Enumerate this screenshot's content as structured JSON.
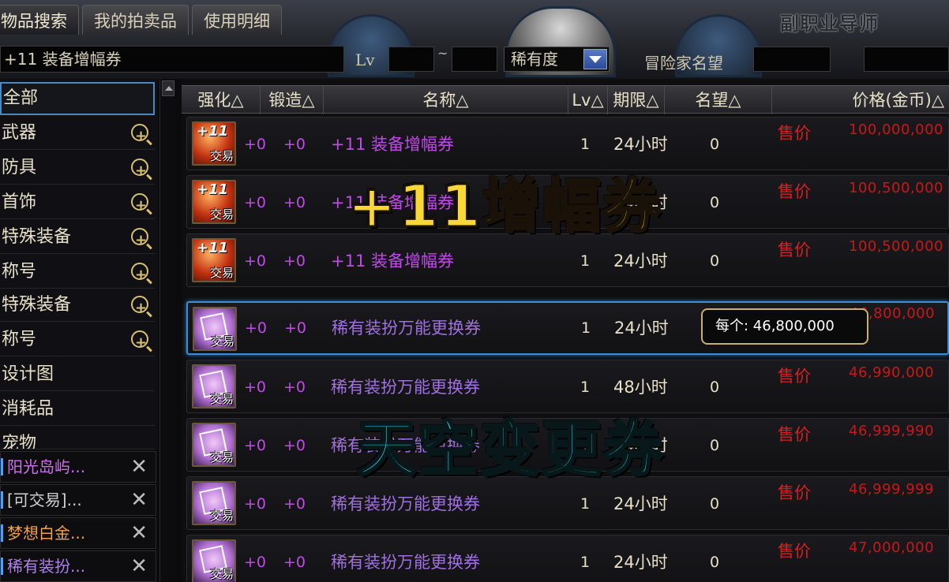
{
  "tabs": [
    "物品搜索",
    "我的拍卖品",
    "使用明细"
  ],
  "brand": {
    "text": "副职业导师"
  },
  "search": {
    "item_value": "+11 装备增幅券",
    "lv_label": "Lv",
    "lv_separator": "~",
    "rarity_label": "稀有度",
    "fame_label": "冒险家名望"
  },
  "sidebar": {
    "categories": [
      {
        "label": "全部",
        "zoom": false
      },
      {
        "label": "武器",
        "zoom": true
      },
      {
        "label": "防具",
        "zoom": true
      },
      {
        "label": "首饰",
        "zoom": true
      },
      {
        "label": "特殊装备",
        "zoom": true
      },
      {
        "label": "称号",
        "zoom": true
      },
      {
        "label": "特殊装备",
        "zoom": true
      },
      {
        "label": "称号",
        "zoom": true
      },
      {
        "label": "设计图",
        "zoom": false
      },
      {
        "label": "消耗品",
        "zoom": false
      },
      {
        "label": "宠物",
        "zoom": false
      }
    ],
    "filters": [
      {
        "label": "阳光岛屿...",
        "color": "#d070f0"
      },
      {
        "label": "[可交易]...",
        "color": "#cfcfcf"
      },
      {
        "label": "梦想白金...",
        "color": "#f0a050"
      },
      {
        "label": "稀有装扮...",
        "color": "#b080f0"
      }
    ]
  },
  "table": {
    "headers": [
      "强化△",
      "锻造△",
      "名称△",
      "Lv△",
      "期限△",
      "名望△",
      "价格(金币)△"
    ],
    "rows": [
      {
        "icon": "amplify-ticket-icon",
        "icon_text": "+11",
        "trade": "交易",
        "upgrade": "+0",
        "forge": "+0",
        "name": "+11 装备增幅券",
        "kind": "amp",
        "lv": "1",
        "duration": "24小时",
        "fame": "0",
        "sell": "售价",
        "price": "100,000,000"
      },
      {
        "icon": "amplify-ticket-icon",
        "icon_text": "+11",
        "trade": "交易",
        "upgrade": "+0",
        "forge": "+0",
        "name": "+11 装备增幅券",
        "kind": "amp",
        "lv": "1",
        "duration": "24小时",
        "fame": "0",
        "sell": "售价",
        "price": "100,500,000"
      },
      {
        "icon": "amplify-ticket-icon",
        "icon_text": "+11",
        "trade": "交易",
        "upgrade": "+0",
        "forge": "+0",
        "name": "+11 装备增幅券",
        "kind": "amp",
        "lv": "1",
        "duration": "24小时",
        "fame": "0",
        "sell": "售价",
        "price": "100,500,000"
      },
      {
        "icon": "avatar-ticket-icon",
        "icon_text": "",
        "trade": "交易",
        "upgrade": "+0",
        "forge": "+0",
        "name": "稀有装扮万能更换券",
        "kind": "ava",
        "lv": "1",
        "duration": "24小时",
        "fame": "0",
        "sell": "售价",
        "price": "46,800,000"
      },
      {
        "icon": "avatar-ticket-icon",
        "icon_text": "",
        "trade": "交易",
        "upgrade": "+0",
        "forge": "+0",
        "name": "稀有装扮万能更换券",
        "kind": "ava",
        "lv": "1",
        "duration": "48小时",
        "fame": "0",
        "sell": "售价",
        "price": "46,990,000"
      },
      {
        "icon": "avatar-ticket-icon",
        "icon_text": "",
        "trade": "交易",
        "upgrade": "+0",
        "forge": "+0",
        "name": "稀有装扮万能更换券",
        "kind": "ava",
        "lv": "1",
        "duration": "24小时",
        "fame": "0",
        "sell": "售价",
        "price": "46,999,990"
      },
      {
        "icon": "avatar-ticket-icon",
        "icon_text": "",
        "trade": "交易",
        "upgrade": "+0",
        "forge": "+0",
        "name": "稀有装扮万能更换券",
        "kind": "ava",
        "lv": "1",
        "duration": "24小时",
        "fame": "0",
        "sell": "售价",
        "price": "46,999,999"
      },
      {
        "icon": "avatar-ticket-icon",
        "icon_text": "",
        "trade": "交易",
        "upgrade": "+0",
        "forge": "+0",
        "name": "稀有装扮万能更换券",
        "kind": "ava",
        "lv": "1",
        "duration": "24小时",
        "fame": "0",
        "sell": "售价",
        "price": "47,000,000"
      }
    ]
  },
  "tooltip": {
    "text": "每个: 46,800,000"
  },
  "overlays": {
    "amp_caption": "+11增幅券",
    "sky_caption": "天空变更券"
  }
}
